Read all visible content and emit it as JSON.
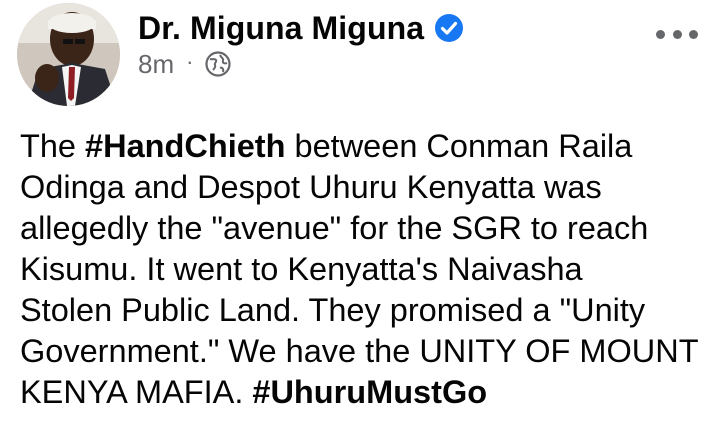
{
  "post": {
    "author": "Dr. Miguna Miguna",
    "verified": true,
    "time": "8m",
    "separator": "·",
    "audience_icon": "globe-icon",
    "more_icon": "more-options-icon",
    "colors": {
      "verified": "#1877f2",
      "meta": "#65676b",
      "text": "#050505"
    },
    "body": {
      "line1_pre": "The ",
      "line1_tag": "#HandChieth",
      "line1_post": " between Conman Raila",
      "line2": "Odinga and Despot Uhuru Kenyatta was",
      "line3": "allegedly the \"avenue\" for the SGR to reach",
      "line4": "Kisumu. It went to Kenyatta's Naivasha",
      "line5": "Stolen Public Land. They promised a \"Unity",
      "line6": "Government.\" We have the UNITY OF MOUNT",
      "line7_pre": "KENYA MAFIA. ",
      "line7_tag": "#UhuruMustGo"
    }
  }
}
